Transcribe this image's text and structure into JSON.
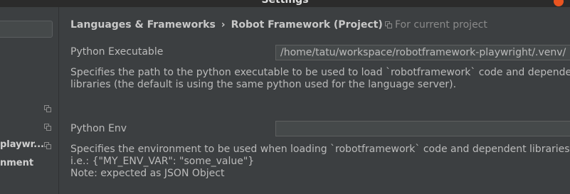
{
  "window": {
    "title": "Settings"
  },
  "sidebar": {
    "items": [
      {
        "label": "playwr..."
      },
      {
        "label": "nment"
      }
    ]
  },
  "breadcrumb": {
    "parent": "Languages & Frameworks",
    "separator": "›",
    "current": "Robot Framework (Project)"
  },
  "scope_label": "For current project",
  "settings": {
    "python_executable": {
      "label": "Python Executable",
      "value": "/home/tatu/workspace/robotframework-playwright/.venv/",
      "description_line1": "Specifies the path to the python executable to be used to load `robotframework` code and dependent",
      "description_line2": "libraries (the default is using the same python used for the language server)."
    },
    "python_env": {
      "label": "Python Env",
      "value": "",
      "description_line1": "Specifies the environment to be used when loading `robotframework` code and dependent libraries.",
      "description_line2": "i.e.: {\"MY_ENV_VAR\": \"some_value\"}",
      "description_line3": "Note: expected as JSON Object"
    }
  },
  "colors": {
    "background": "#3c3f41",
    "field_background": "#45494a",
    "text": "#bbbbbb",
    "accent_close": "#e95420"
  }
}
